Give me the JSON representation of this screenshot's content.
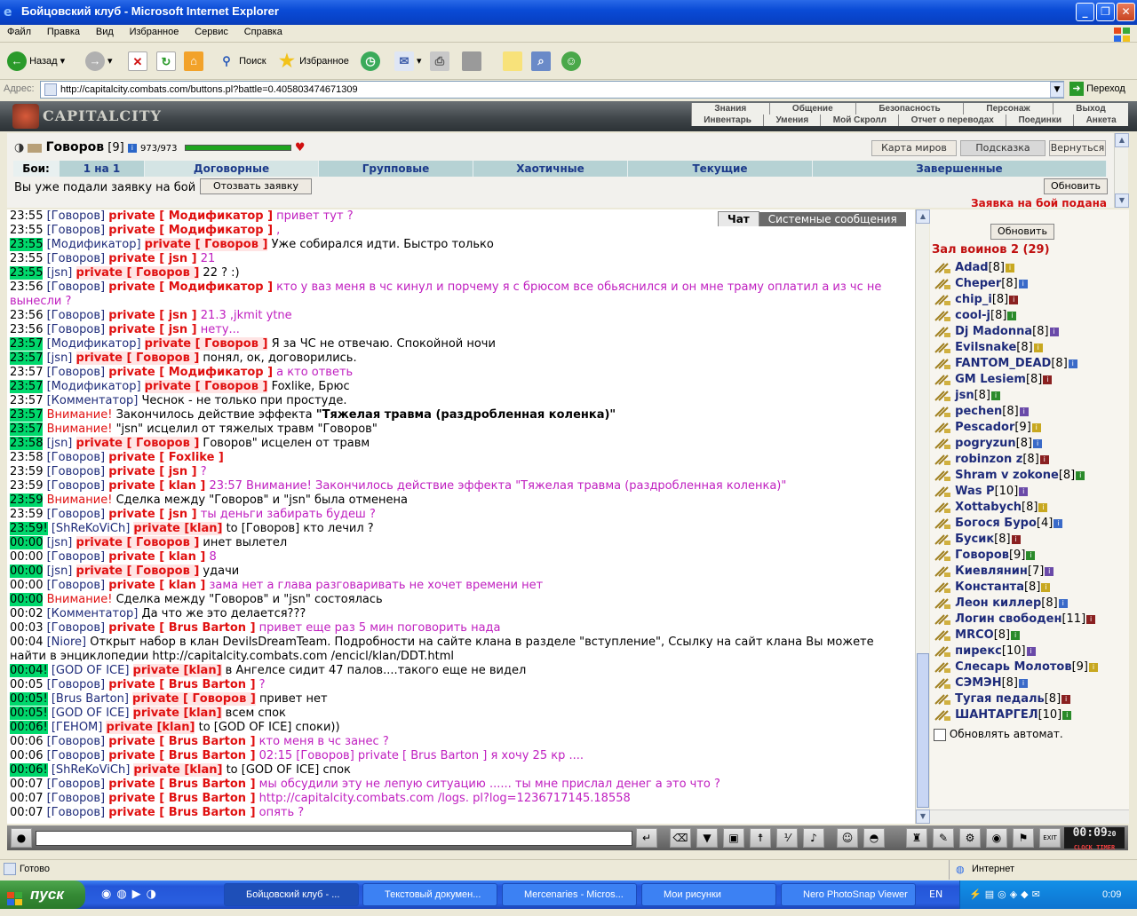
{
  "window": {
    "title": "Бойцовский клуб - Microsoft Internet Explorer"
  },
  "menu": [
    "Файл",
    "Правка",
    "Вид",
    "Избранное",
    "Сервис",
    "Справка"
  ],
  "toolbar": {
    "back": "Назад",
    "search": "Поиск",
    "favorites": "Избранное"
  },
  "address": {
    "label": "Адрес:",
    "url": "http://capitalcity.combats.com/buttons.pl?battle=0.405803474671309",
    "go": "Переход"
  },
  "site": {
    "logo": "CAPITALCITY",
    "nav_top": [
      "Знания",
      "Общение",
      "Безопасность",
      "Персонаж",
      "Выход"
    ],
    "nav_bottom": [
      "Инвентарь",
      "Умения",
      "Мой Скролл",
      "Отчет о переводах",
      "Поединки",
      "Анкета"
    ]
  },
  "player": {
    "name": "Говоров",
    "level": "[9]",
    "hp": "973/973"
  },
  "buttons": {
    "world_map": "Карта миров",
    "hint": "Подсказка",
    "back": "Вернуться",
    "withdraw": "Отозвать заявку",
    "refresh": "Обновить",
    "refresh_right": "Обновить"
  },
  "fights": {
    "label": "Бои:",
    "tabs": [
      "1 на 1",
      "Договорные",
      "Групповые",
      "Хаотичные",
      "Текущие",
      "Завершенные"
    ]
  },
  "pending": "Вы уже подали заявку на бой",
  "bid_submitted": "Заявка на бой подана",
  "chat_tabs": {
    "chat": "Чат",
    "system": "Системные сообщения"
  },
  "chat": [
    {
      "t": "23:55",
      "hl": false,
      "parts": [
        [
          "nick",
          "[Говоров]"
        ],
        [
          "priv",
          "private [ Модификатор ]"
        ],
        [
          "mine",
          "привет тут ?"
        ]
      ]
    },
    {
      "t": "23:55",
      "hl": false,
      "parts": [
        [
          "nick",
          "[Говоров]"
        ],
        [
          "priv",
          "private [ Модификатор ]"
        ],
        [
          "mine",
          ","
        ]
      ]
    },
    {
      "t": "23:55",
      "hl": true,
      "parts": [
        [
          "nick",
          "[Модификатор]"
        ],
        [
          "priv",
          "private [ Говоров ]"
        ],
        [
          "other",
          "Уже собирался идти. Быстро только"
        ]
      ]
    },
    {
      "t": "23:55",
      "hl": false,
      "parts": [
        [
          "nick",
          "[Говоров]"
        ],
        [
          "priv",
          "private [ jsn ]"
        ],
        [
          "mine",
          "21"
        ]
      ]
    },
    {
      "t": "23:55",
      "hl": true,
      "parts": [
        [
          "nick",
          "[jsn]"
        ],
        [
          "priv",
          "private [ Говоров ]"
        ],
        [
          "other",
          "22 ? :)"
        ]
      ]
    },
    {
      "t": "23:56",
      "hl": false,
      "parts": [
        [
          "nick",
          "[Говоров]"
        ],
        [
          "priv",
          "private [ Модификатор ]"
        ],
        [
          "mine",
          "кто у ваз меня в чс кинул и порчему я с брюсом все обьяснился и он мне траму оплатил а из чс не"
        ]
      ]
    },
    {
      "t": "",
      "hl": false,
      "parts": [
        [
          "mine",
          "вынесли ?"
        ]
      ]
    },
    {
      "t": "23:56",
      "hl": false,
      "parts": [
        [
          "nick",
          "[Говоров]"
        ],
        [
          "priv",
          "private [ jsn ]"
        ],
        [
          "mine",
          "21.3 ,jkmit ytne"
        ]
      ]
    },
    {
      "t": "23:56",
      "hl": false,
      "parts": [
        [
          "nick",
          "[Говоров]"
        ],
        [
          "priv",
          "private [ jsn ]"
        ],
        [
          "mine",
          "нету..."
        ]
      ]
    },
    {
      "t": "23:57",
      "hl": true,
      "parts": [
        [
          "nick",
          "[Модификатор]"
        ],
        [
          "priv",
          "private [ Говоров ]"
        ],
        [
          "other",
          "Я за ЧС не отвечаю. Спокойной ночи"
        ]
      ]
    },
    {
      "t": "23:57",
      "hl": true,
      "parts": [
        [
          "nick",
          "[jsn]"
        ],
        [
          "priv",
          "private [ Говоров ]"
        ],
        [
          "other",
          "понял, ок, договорились."
        ]
      ]
    },
    {
      "t": "23:57",
      "hl": false,
      "parts": [
        [
          "nick",
          "[Говоров]"
        ],
        [
          "priv",
          "private [ Модификатор ]"
        ],
        [
          "mine",
          "а кто ответь"
        ]
      ]
    },
    {
      "t": "23:57",
      "hl": true,
      "parts": [
        [
          "nick",
          "[Модификатор]"
        ],
        [
          "priv",
          "private [ Говоров ]"
        ],
        [
          "other",
          "Foxlike, Брюс"
        ]
      ]
    },
    {
      "t": "23:57",
      "hl": false,
      "parts": [
        [
          "nick",
          "[Комментатор]"
        ],
        [
          "other",
          "Чеснок - не только при простуде."
        ]
      ]
    },
    {
      "t": "23:57",
      "hl": true,
      "parts": [
        [
          "warn",
          "Внимание!"
        ],
        [
          "other",
          "Закончилось действие эффекта"
        ],
        [
          "bold",
          "\"Тяжелая травма (раздробленная коленка)\""
        ]
      ]
    },
    {
      "t": "23:57",
      "hl": true,
      "parts": [
        [
          "warn",
          "Внимание!"
        ],
        [
          "other",
          "\"jsn\" исцелил от тяжелых травм \"Говоров\""
        ]
      ]
    },
    {
      "t": "23:58",
      "hl": true,
      "parts": [
        [
          "nick",
          "[jsn]"
        ],
        [
          "priv",
          "private [ Говоров ]"
        ],
        [
          "other",
          "Говоров\" исцелен от травм"
        ]
      ]
    },
    {
      "t": "23:58",
      "hl": false,
      "parts": [
        [
          "nick",
          "[Говоров]"
        ],
        [
          "priv",
          "private [ Foxlike ]"
        ]
      ]
    },
    {
      "t": "23:59",
      "hl": false,
      "parts": [
        [
          "nick",
          "[Говоров]"
        ],
        [
          "priv",
          "private [ jsn ]"
        ],
        [
          "mine",
          "?"
        ]
      ]
    },
    {
      "t": "23:59",
      "hl": false,
      "parts": [
        [
          "nick",
          "[Говоров]"
        ],
        [
          "priv",
          "private [ klan ]"
        ],
        [
          "mine",
          "23:57 Внимание! Закончилось действие эффекта \"Тяжелая травма (раздробленная коленка)\""
        ]
      ]
    },
    {
      "t": "23:59",
      "hl": true,
      "parts": [
        [
          "warn",
          "Внимание!"
        ],
        [
          "other",
          "Сделка между \"Говоров\" и \"jsn\" была отменена"
        ]
      ]
    },
    {
      "t": "23:59",
      "hl": false,
      "parts": [
        [
          "nick",
          "[Говоров]"
        ],
        [
          "priv",
          "private [ jsn ]"
        ],
        [
          "mine",
          "ты деньги забирать будеш ?"
        ]
      ]
    },
    {
      "t": "23:59!",
      "hl": true,
      "parts": [
        [
          "nick",
          "[ShReKoViCh]"
        ],
        [
          "priv",
          "private [klan]"
        ],
        [
          "other",
          "to [Говоров] кто лечил ?"
        ]
      ]
    },
    {
      "t": "00:00",
      "hl": true,
      "parts": [
        [
          "nick",
          "[jsn]"
        ],
        [
          "priv",
          "private [ Говоров ]"
        ],
        [
          "other",
          "инет вылетел"
        ]
      ]
    },
    {
      "t": "00:00",
      "hl": false,
      "parts": [
        [
          "nick",
          "[Говоров]"
        ],
        [
          "priv",
          "private [ klan ]"
        ],
        [
          "mine",
          "8"
        ]
      ]
    },
    {
      "t": "00:00",
      "hl": true,
      "parts": [
        [
          "nick",
          "[jsn]"
        ],
        [
          "priv",
          "private [ Говоров ]"
        ],
        [
          "other",
          "удачи"
        ]
      ]
    },
    {
      "t": "00:00",
      "hl": false,
      "parts": [
        [
          "nick",
          "[Говоров]"
        ],
        [
          "priv",
          "private [ klan ]"
        ],
        [
          "mine",
          "зама нет а глава разговаривать не хочет времени нет"
        ]
      ]
    },
    {
      "t": "00:00",
      "hl": true,
      "parts": [
        [
          "warn",
          "Внимание!"
        ],
        [
          "other",
          "Сделка между \"Говоров\" и \"jsn\" состоялась"
        ]
      ]
    },
    {
      "t": "00:02",
      "hl": false,
      "parts": [
        [
          "nick",
          "[Комментатор]"
        ],
        [
          "other",
          "Да что же это делается???"
        ]
      ]
    },
    {
      "t": "00:03",
      "hl": false,
      "parts": [
        [
          "nick",
          "[Говоров]"
        ],
        [
          "priv",
          "private [ Brus Barton ]"
        ],
        [
          "mine",
          "привет еще раз 5 мин поговорить нада"
        ]
      ]
    },
    {
      "t": "00:04",
      "hl": false,
      "parts": [
        [
          "nick",
          "[Niore]"
        ],
        [
          "other",
          "Открыт набор в клан DevilsDreamTeam. Подробности на сайте клана в разделе \"вступление\", Ссылку на сайт клана Вы можете"
        ]
      ]
    },
    {
      "t": "",
      "hl": false,
      "parts": [
        [
          "other",
          "найти в энциклопедии http://capitalcity.combats.com /encicl/klan/DDT.html"
        ]
      ]
    },
    {
      "t": "00:04!",
      "hl": true,
      "parts": [
        [
          "nick",
          "[GOD OF ICE]"
        ],
        [
          "priv",
          "private [klan]"
        ],
        [
          "other",
          "в Ангелсе сидит 47 палов....такого еще не видел"
        ]
      ]
    },
    {
      "t": "00:05",
      "hl": false,
      "parts": [
        [
          "nick",
          "[Говоров]"
        ],
        [
          "priv",
          "private [ Brus Barton ]"
        ],
        [
          "mine",
          "?"
        ]
      ]
    },
    {
      "t": "00:05!",
      "hl": true,
      "parts": [
        [
          "nick",
          "[Brus Barton]"
        ],
        [
          "priv",
          "private [ Говоров ]"
        ],
        [
          "other",
          "привет нет"
        ]
      ]
    },
    {
      "t": "00:05!",
      "hl": true,
      "parts": [
        [
          "nick",
          "[GOD OF ICE]"
        ],
        [
          "priv",
          "private [klan]"
        ],
        [
          "other",
          "всем спок"
        ]
      ]
    },
    {
      "t": "00:06!",
      "hl": true,
      "parts": [
        [
          "nick",
          "[ГЕНОМ]"
        ],
        [
          "priv",
          "private [klan]"
        ],
        [
          "other",
          "to [GOD OF ICE] споки))"
        ]
      ]
    },
    {
      "t": "00:06",
      "hl": false,
      "parts": [
        [
          "nick",
          "[Говоров]"
        ],
        [
          "priv",
          "private [ Brus Barton ]"
        ],
        [
          "mine",
          "кто меня в чс занес ?"
        ]
      ]
    },
    {
      "t": "00:06",
      "hl": false,
      "parts": [
        [
          "nick",
          "[Говоров]"
        ],
        [
          "priv",
          "private [ Brus Barton ]"
        ],
        [
          "mine",
          "02:15 [Говоров] private [ Brus Barton ] я хочу 25 кр ...."
        ]
      ]
    },
    {
      "t": "00:06!",
      "hl": true,
      "parts": [
        [
          "nick",
          "[ShReKoViCh]"
        ],
        [
          "priv",
          "private [klan]"
        ],
        [
          "other",
          "to [GOD OF ICE] спок"
        ]
      ]
    },
    {
      "t": "00:07",
      "hl": false,
      "parts": [
        [
          "nick",
          "[Говоров]"
        ],
        [
          "priv",
          "private [ Brus Barton ]"
        ],
        [
          "mine",
          "мы обсудили эту не лепую ситуацию ...... ты мне прислал денег а это что ?"
        ]
      ]
    },
    {
      "t": "00:07",
      "hl": false,
      "parts": [
        [
          "nick",
          "[Говоров]"
        ],
        [
          "priv",
          "private [ Brus Barton ]"
        ],
        [
          "mine",
          "http://capitalcity.combats.com /logs. pl?log=1236717145.18558"
        ]
      ]
    },
    {
      "t": "00:07",
      "hl": false,
      "parts": [
        [
          "nick",
          "[Говоров]"
        ],
        [
          "priv",
          "private [ Brus Barton ]"
        ],
        [
          "mine",
          "опять ?"
        ]
      ]
    }
  ],
  "hall": {
    "title": "Зал воинов 2 (29)",
    "warriors": [
      {
        "name": "Adad",
        "lvl": "[8]"
      },
      {
        "name": "Cheper",
        "lvl": "[8]"
      },
      {
        "name": "chip_i",
        "lvl": "[8]"
      },
      {
        "name": "cool-j",
        "lvl": "[8]"
      },
      {
        "name": "Dj Madonna",
        "lvl": "[8]"
      },
      {
        "name": "Evilsnake",
        "lvl": "[8]"
      },
      {
        "name": "FANTOM_DEAD",
        "lvl": "[8]"
      },
      {
        "name": "GM Lesiem",
        "lvl": "[8]"
      },
      {
        "name": "jsn",
        "lvl": "[8]"
      },
      {
        "name": "pechen",
        "lvl": "[8]"
      },
      {
        "name": "Pescador",
        "lvl": "[9]"
      },
      {
        "name": "pogryzun",
        "lvl": "[8]"
      },
      {
        "name": "robinzon z",
        "lvl": "[8]"
      },
      {
        "name": "Shram v zokone",
        "lvl": "[8]"
      },
      {
        "name": "Was P",
        "lvl": "[10]"
      },
      {
        "name": "Xottabych",
        "lvl": "[8]"
      },
      {
        "name": "Богося Буро",
        "lvl": "[4]"
      },
      {
        "name": "Бусик",
        "lvl": "[8]"
      },
      {
        "name": "Говоров",
        "lvl": "[9]"
      },
      {
        "name": "Киевлянин",
        "lvl": "[7]"
      },
      {
        "name": "Константа",
        "lvl": "[8]"
      },
      {
        "name": "Леон киллер",
        "lvl": "[8]"
      },
      {
        "name": "Логин свободен",
        "lvl": "[11]"
      },
      {
        "name": "MRCO",
        "lvl": "[8]"
      },
      {
        "name": "пирекс",
        "lvl": "[10]"
      },
      {
        "name": "Слесарь Молотов",
        "lvl": "[9]"
      },
      {
        "name": "СЭМЭН",
        "lvl": "[8]"
      },
      {
        "name": "Тугая педаль",
        "lvl": "[8]"
      },
      {
        "name": "ШАНТАРГЕЛ",
        "lvl": "[10]"
      }
    ],
    "auto_refresh": "Обновлять автомат."
  },
  "clock": {
    "time": "00:09",
    "seconds": "20",
    "label": "CLOCK TIMER"
  },
  "status": {
    "text": "Готово",
    "zone": "Интернет"
  },
  "taskbar": {
    "start": "пуск",
    "tasks": [
      "Бойцовский клуб - ...",
      "Текстовый докумен...",
      "Mercenaries - Micros...",
      "Мои рисунки",
      "Nero PhotoSnap Viewer"
    ],
    "lang": "EN",
    "time": "0:09"
  },
  "colors": {
    "accent": "#0a4bd6",
    "hl": "#00d86c",
    "private": "#e01010",
    "own": "#c020c0",
    "nick": "#1e2b7a"
  }
}
